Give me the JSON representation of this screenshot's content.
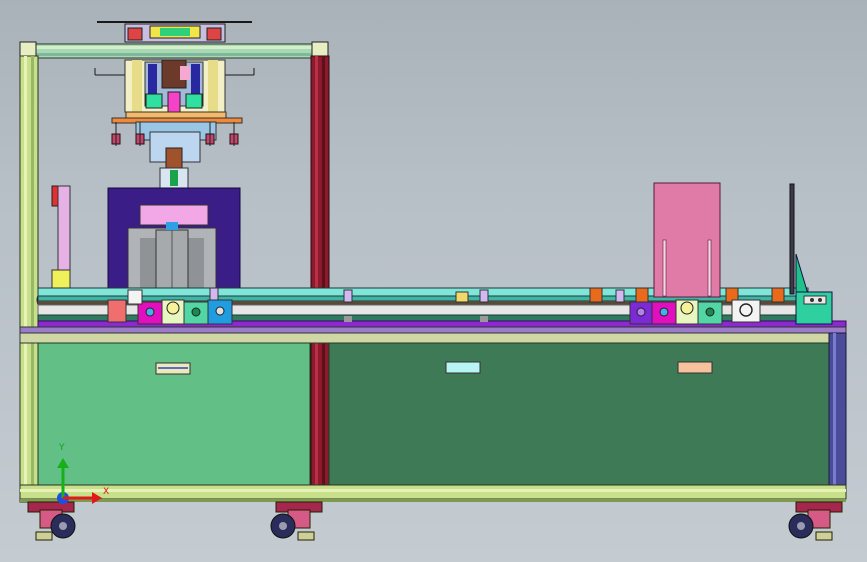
{
  "colors": {
    "background": "#b4bcc4",
    "frame_yellow_green": "#c8e08c",
    "frame_dark_red": "#8c1a2a",
    "cabinet_left": "#62bf86",
    "cabinet_right": "#3f7a56",
    "base_purple": "#6a1b9a",
    "press_navy": "#3b1d88",
    "pink_panel": "#e07ba8",
    "rail_cyan": "#7fe6d9",
    "magenta_block": "#e10fbe",
    "blue_block": "#1f9de0",
    "caster_maroon": "#a6274e",
    "axis_x": "#e01a1a",
    "axis_y": "#18b018",
    "axis_z": "#1f4fe0"
  },
  "axes": {
    "x_label": "X",
    "y_label": "Y"
  }
}
